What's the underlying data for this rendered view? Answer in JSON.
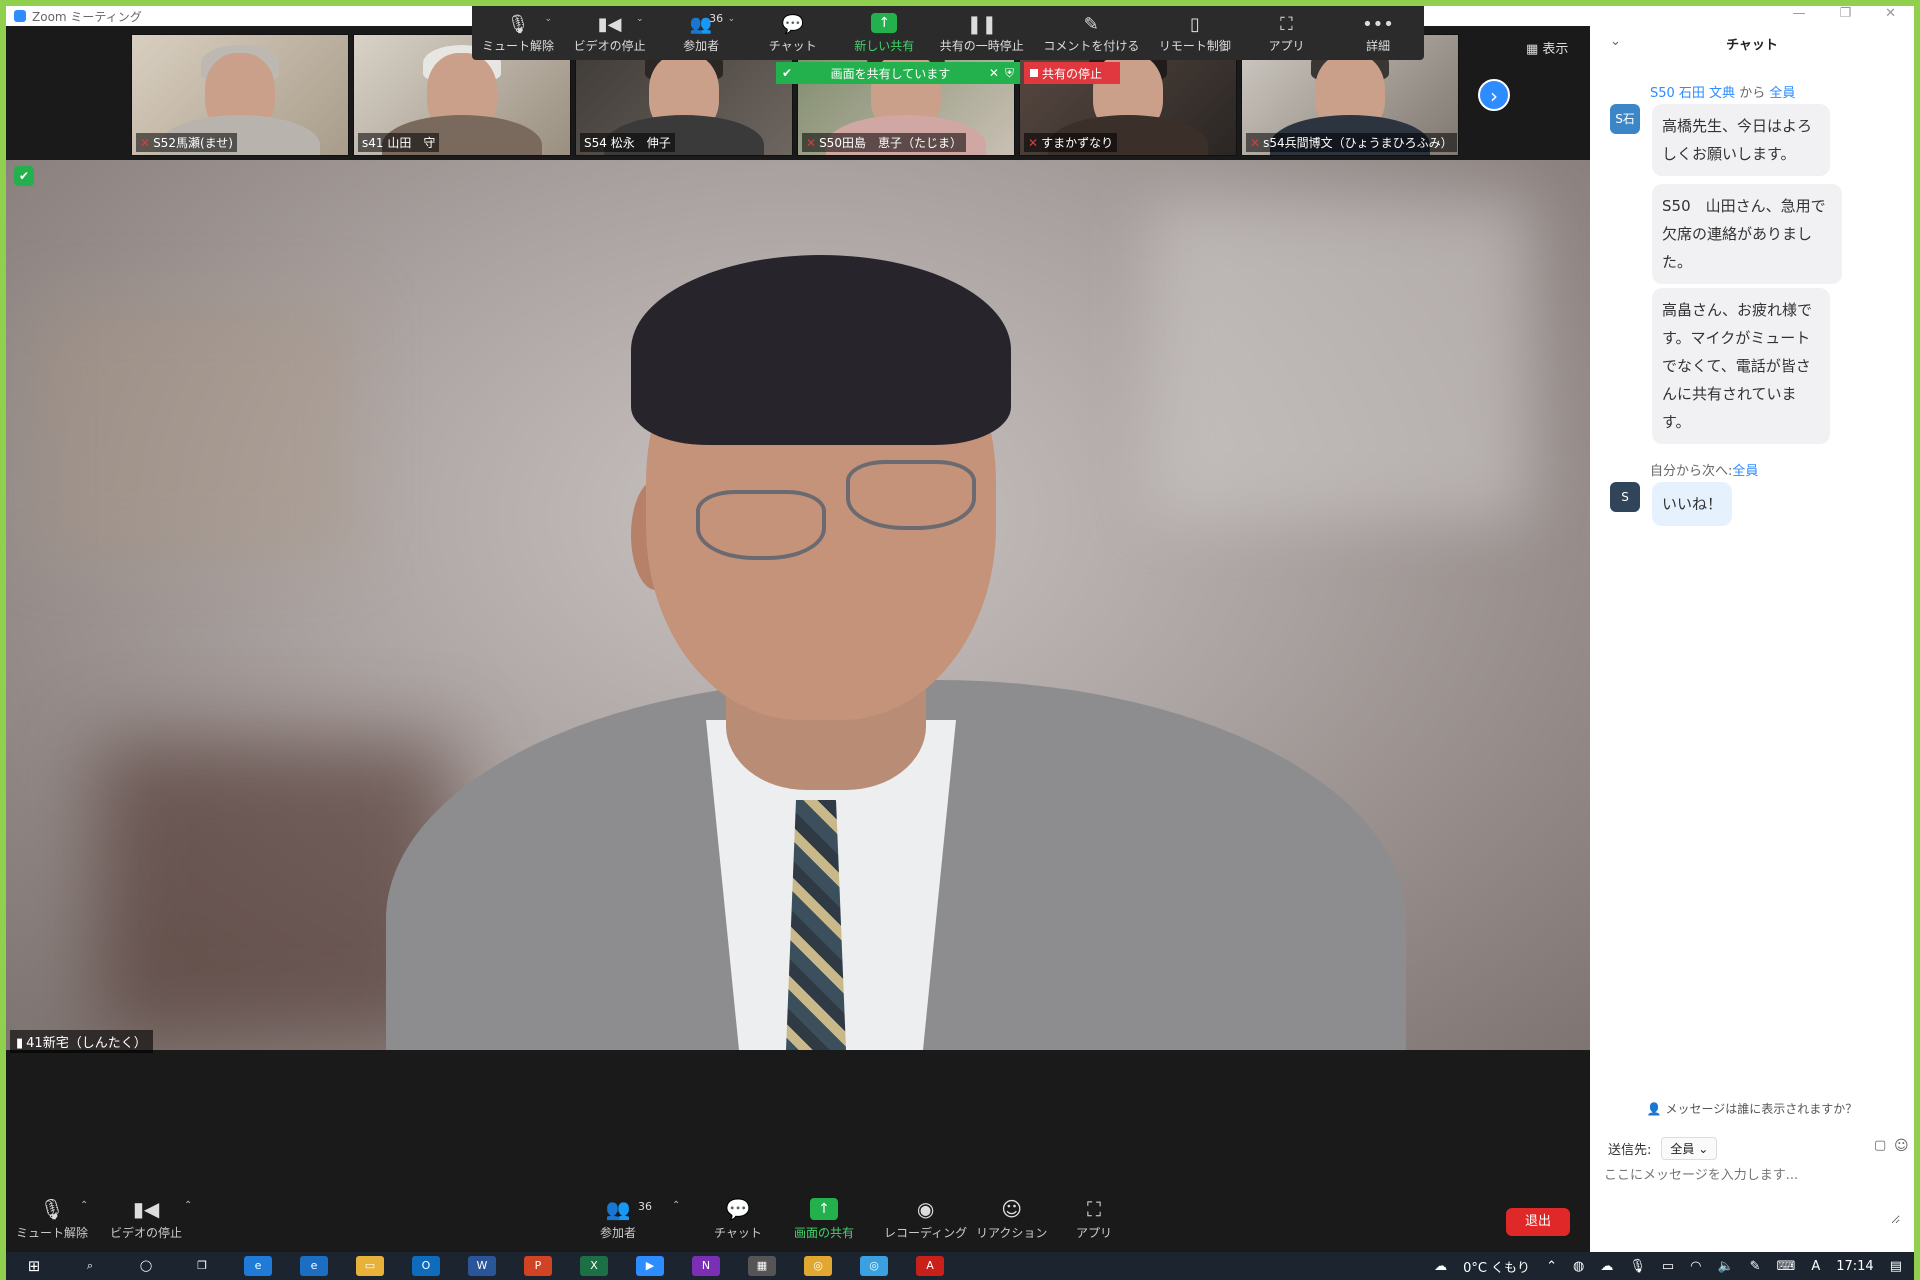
{
  "window": {
    "title": "Zoom ミーティング"
  },
  "share_toolbar": {
    "items": [
      {
        "name": "unmute",
        "label": "ミュート解除",
        "icon": "mic-off-icon"
      },
      {
        "name": "stop-video",
        "label": "ビデオの停止",
        "icon": "video-camera-icon"
      },
      {
        "name": "participants",
        "label": "参加者",
        "icon": "participants-icon",
        "count": "36"
      },
      {
        "name": "chat",
        "label": "チャット",
        "icon": "chat-icon"
      },
      {
        "name": "new-share",
        "label": "新しい共有",
        "icon": "share-up-arrow-icon"
      },
      {
        "name": "pause-share",
        "label": "共有の一時停止",
        "icon": "pause-icon"
      },
      {
        "name": "annotate",
        "label": "コメントを付ける",
        "icon": "pencil-icon"
      },
      {
        "name": "remote-control",
        "label": "リモート制御",
        "icon": "mouse-icon"
      },
      {
        "name": "apps",
        "label": "アプリ",
        "icon": "apps-icon"
      },
      {
        "name": "more",
        "label": "詳細",
        "icon": "more-dots-icon"
      }
    ]
  },
  "view_button": "表示",
  "share_banner": {
    "text": "画面を共有しています",
    "stop_label": "共有の停止"
  },
  "thumbnails": [
    {
      "name": "S52馬瀬(ませ)"
    },
    {
      "name": "s41 山田　守"
    },
    {
      "name": "S54 松永　伸子"
    },
    {
      "name": "S50田島　恵子（たじま）"
    },
    {
      "name": "すまかずなり"
    },
    {
      "name": "s54兵間博文（ひょうまひろふみ）"
    }
  ],
  "active_speaker": {
    "name": "41新宅（しんたく）"
  },
  "bottom_toolbar": {
    "unmute": "ミュート解除",
    "stop_video": "ビデオの停止",
    "participants": "参加者",
    "participants_count": "36",
    "chat": "チャット",
    "share_screen": "画面の共有",
    "recording": "レコーディング",
    "reaction": "リアクション",
    "apps": "アプリ",
    "leave": "退出"
  },
  "chat": {
    "title": "チャット",
    "messages": [
      {
        "sender": "S50 石田 文典",
        "connector": "から",
        "recipient": "全員",
        "avatar_text": "S石",
        "avatar_color": "#3b86c6",
        "texts": [
          "高橋先生、今日はよろしくお願いします。",
          "S50　山田さん、急用で欠席の連絡がありました。",
          "高畠さん、お疲れ様です。マイクがミュートでなくて、電話が皆さんに共有されています。"
        ]
      },
      {
        "sender_prefix": "自分から次へ:",
        "recipient": "全員",
        "avatar_text": "S",
        "avatar_color": "#30445a",
        "texts": [
          "いいね！"
        ]
      }
    ],
    "who_can_see": "メッセージは誰に表示されますか？",
    "send_to_label": "送信先:",
    "send_to_value": "全員",
    "input_placeholder": "ここにメッセージを入力します..."
  },
  "taskbar": {
    "weather": "0°C くもり",
    "clock": "17:14",
    "ime": "A"
  },
  "colors": {
    "zoom_blue": "#2d8cff",
    "share_green": "#23b14d",
    "stop_red": "#e0383e",
    "border_green": "#8fd14f"
  }
}
